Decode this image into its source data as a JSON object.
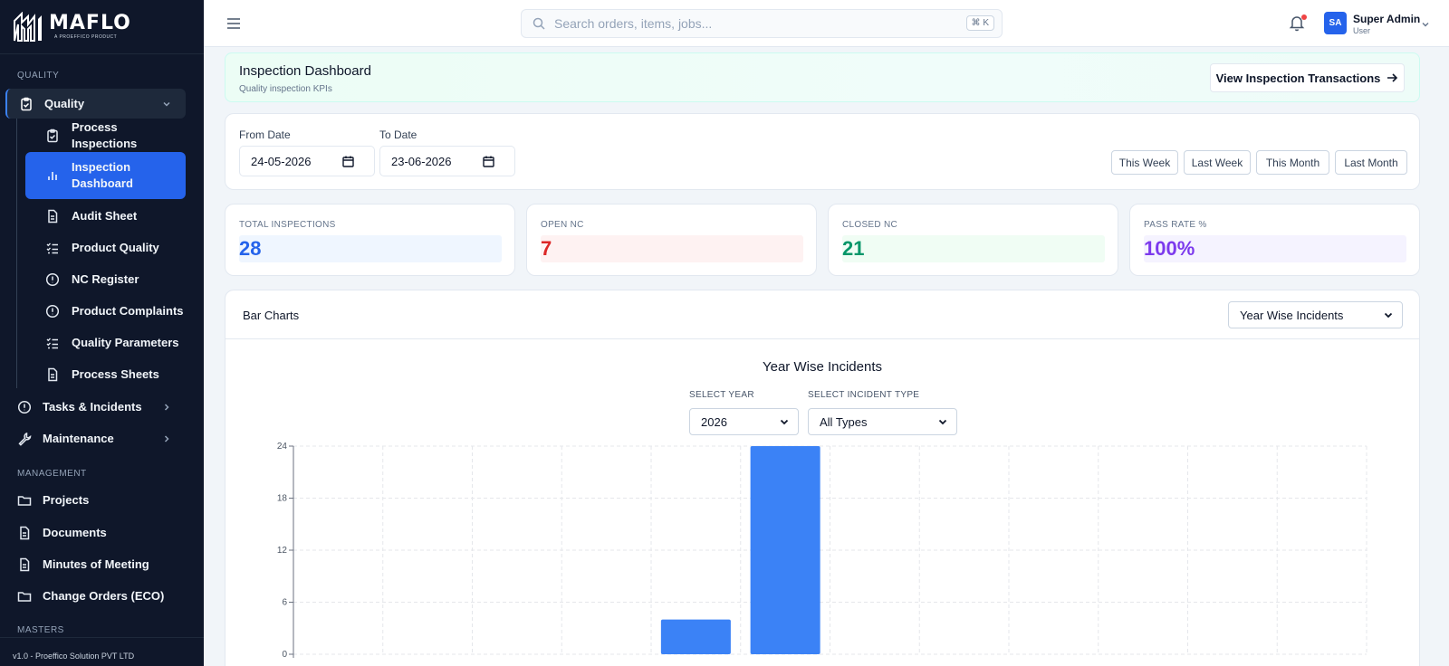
{
  "sidebar": {
    "brand": "MAFLO",
    "brand_sub": "A PROEFFICO PRODUCT",
    "sections": {
      "quality": "QUALITY",
      "management": "MANAGEMENT",
      "masters": "MASTERS"
    },
    "quality_parent": "Quality",
    "quality_children": [
      {
        "label": "Process Inspections",
        "icon": "clipboard-check-icon"
      },
      {
        "label": "Inspection Dashboard",
        "icon": "bar-chart-icon"
      },
      {
        "label": "Audit Sheet",
        "icon": "document-icon"
      },
      {
        "label": "Product Quality",
        "icon": "list-check-icon"
      },
      {
        "label": "NC Register",
        "icon": "alert-circle-icon"
      },
      {
        "label": "Product Complaints",
        "icon": "alert-circle-icon"
      },
      {
        "label": "Quality Parameters",
        "icon": "list-check-icon"
      },
      {
        "label": "Process Sheets",
        "icon": "document-icon"
      }
    ],
    "tasks": "Tasks & Incidents",
    "maintenance": "Maintenance",
    "management_items": [
      {
        "label": "Projects",
        "icon": "folder-icon"
      },
      {
        "label": "Documents",
        "icon": "document-icon"
      },
      {
        "label": "Minutes of Meeting",
        "icon": "document-icon"
      },
      {
        "label": "Change Orders (ECO)",
        "icon": "folder-icon"
      }
    ],
    "version": "v1.0 - Proeffico Solution PVT LTD"
  },
  "topbar": {
    "search_placeholder": "Search orders, items, jobs...",
    "shortcut": "⌘ K",
    "avatar_initials": "SA",
    "user_name": "Super Admin",
    "user_role": "User"
  },
  "banner": {
    "title": "Inspection Dashboard",
    "subtitle": "Quality inspection KPIs",
    "button": "View Inspection Transactions"
  },
  "filters": {
    "from_label": "From Date",
    "from_value": "24-05-2026",
    "to_label": "To Date",
    "to_value": "23-06-2026",
    "ranges": [
      "This Week",
      "Last Week",
      "This Month",
      "Last Month"
    ]
  },
  "kpis": [
    {
      "label": "TOTAL INSPECTIONS",
      "value": "28",
      "color": "#2563eb",
      "bg": "#eff6ff"
    },
    {
      "label": "OPEN NC",
      "value": "7",
      "color": "#dc2626",
      "bg": "#fef2f2"
    },
    {
      "label": "CLOSED NC",
      "value": "21",
      "color": "#059669",
      "bg": "#f0fdf4"
    },
    {
      "label": "PASS RATE %",
      "value": "100%",
      "color": "#7c3aed",
      "bg": "#f5f3ff"
    }
  ],
  "chart_panel": {
    "header": "Bar Charts",
    "chart_selector": "Year Wise Incidents",
    "title": "Year Wise Incidents",
    "year_label": "SELECT YEAR",
    "year_value": "2026",
    "type_label": "SELECT INCIDENT TYPE",
    "type_value": "All Types"
  },
  "chart_data": {
    "type": "bar",
    "title": "Year Wise Incidents",
    "categories": [
      "",
      "",
      "",
      "",
      "",
      "",
      "",
      "",
      "",
      "",
      "",
      ""
    ],
    "values": [
      0,
      0,
      0,
      0,
      4,
      24,
      0,
      0,
      0,
      0,
      0,
      0
    ],
    "ylim": [
      0,
      24
    ],
    "yticks": [
      0,
      6,
      12,
      18,
      24
    ],
    "bar_color": "#3b82f6",
    "grid": true
  }
}
